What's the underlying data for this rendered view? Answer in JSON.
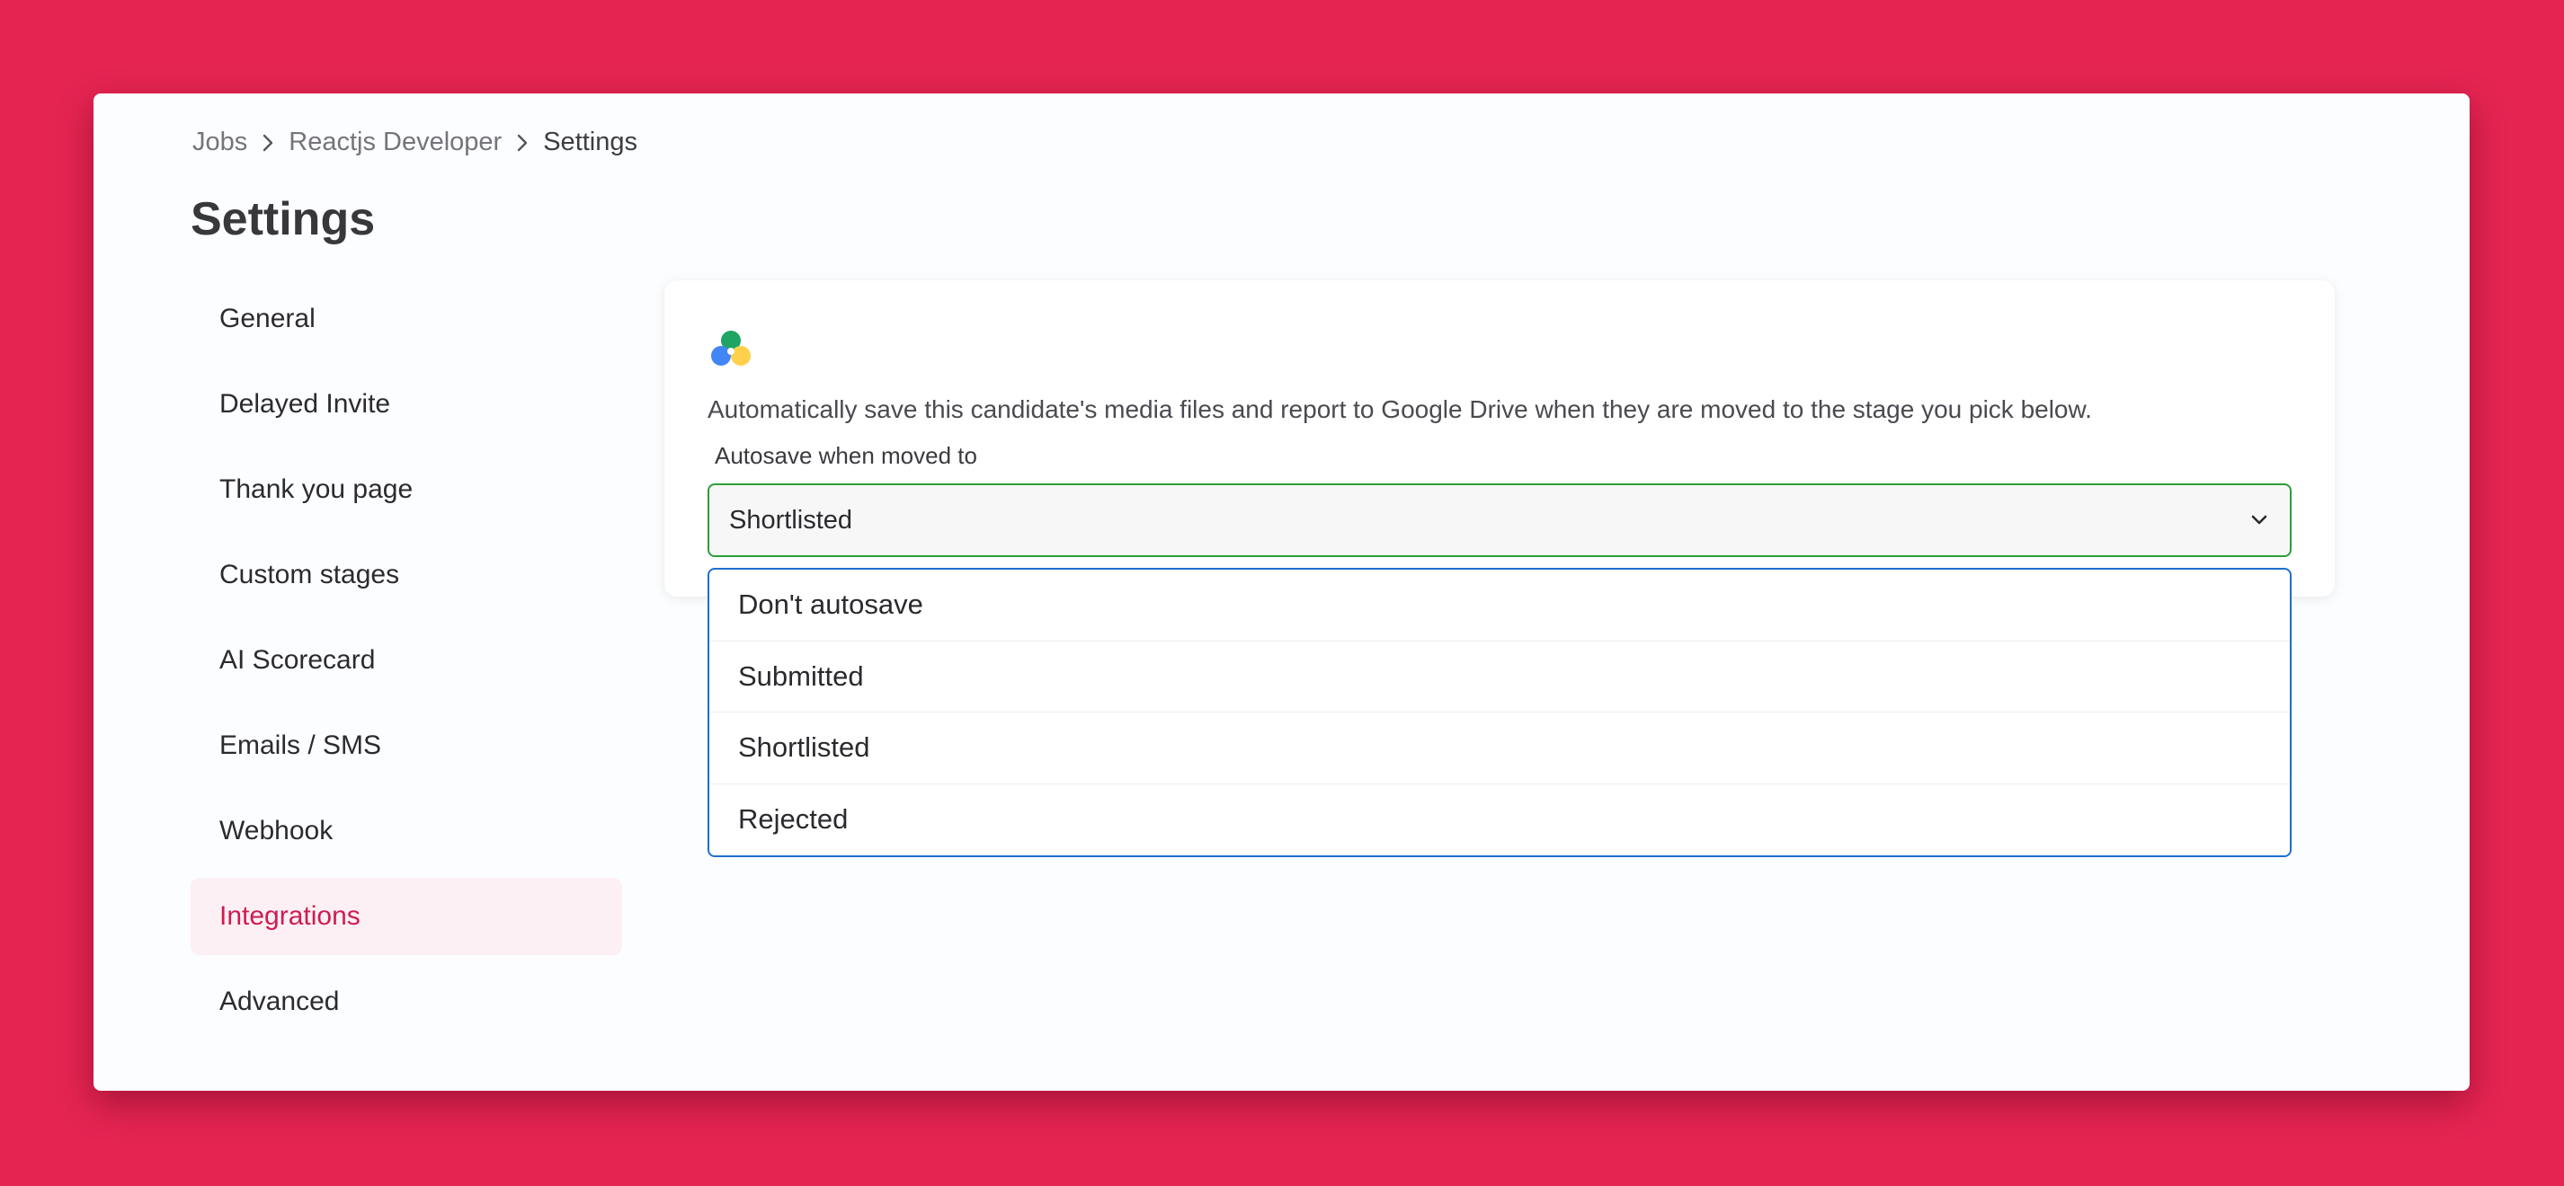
{
  "breadcrumb": {
    "items": [
      "Jobs",
      "Reactjs Developer",
      "Settings"
    ]
  },
  "page": {
    "title": "Settings"
  },
  "sidebar": {
    "items": [
      {
        "label": "General"
      },
      {
        "label": "Delayed Invite"
      },
      {
        "label": "Thank you page"
      },
      {
        "label": "Custom stages"
      },
      {
        "label": "AI Scorecard"
      },
      {
        "label": "Emails / SMS"
      },
      {
        "label": "Webhook"
      },
      {
        "label": "Integrations",
        "active": true
      },
      {
        "label": "Advanced"
      }
    ]
  },
  "integration": {
    "icon": "google-drive-icon",
    "description": "Automatically save this candidate's media files and report to Google Drive when they are moved to the stage you pick below.",
    "field_label": "Autosave when moved to",
    "selected_value": "Shortlisted",
    "options": [
      "Don't autosave",
      "Submitted",
      "Shortlisted",
      "Rejected"
    ]
  },
  "colors": {
    "background": "#e52452",
    "accent": "#d01c51",
    "active_nav_bg": "#fcf0f4",
    "select_border": "#2e9d3a",
    "dropdown_border": "#1f6fd2"
  }
}
